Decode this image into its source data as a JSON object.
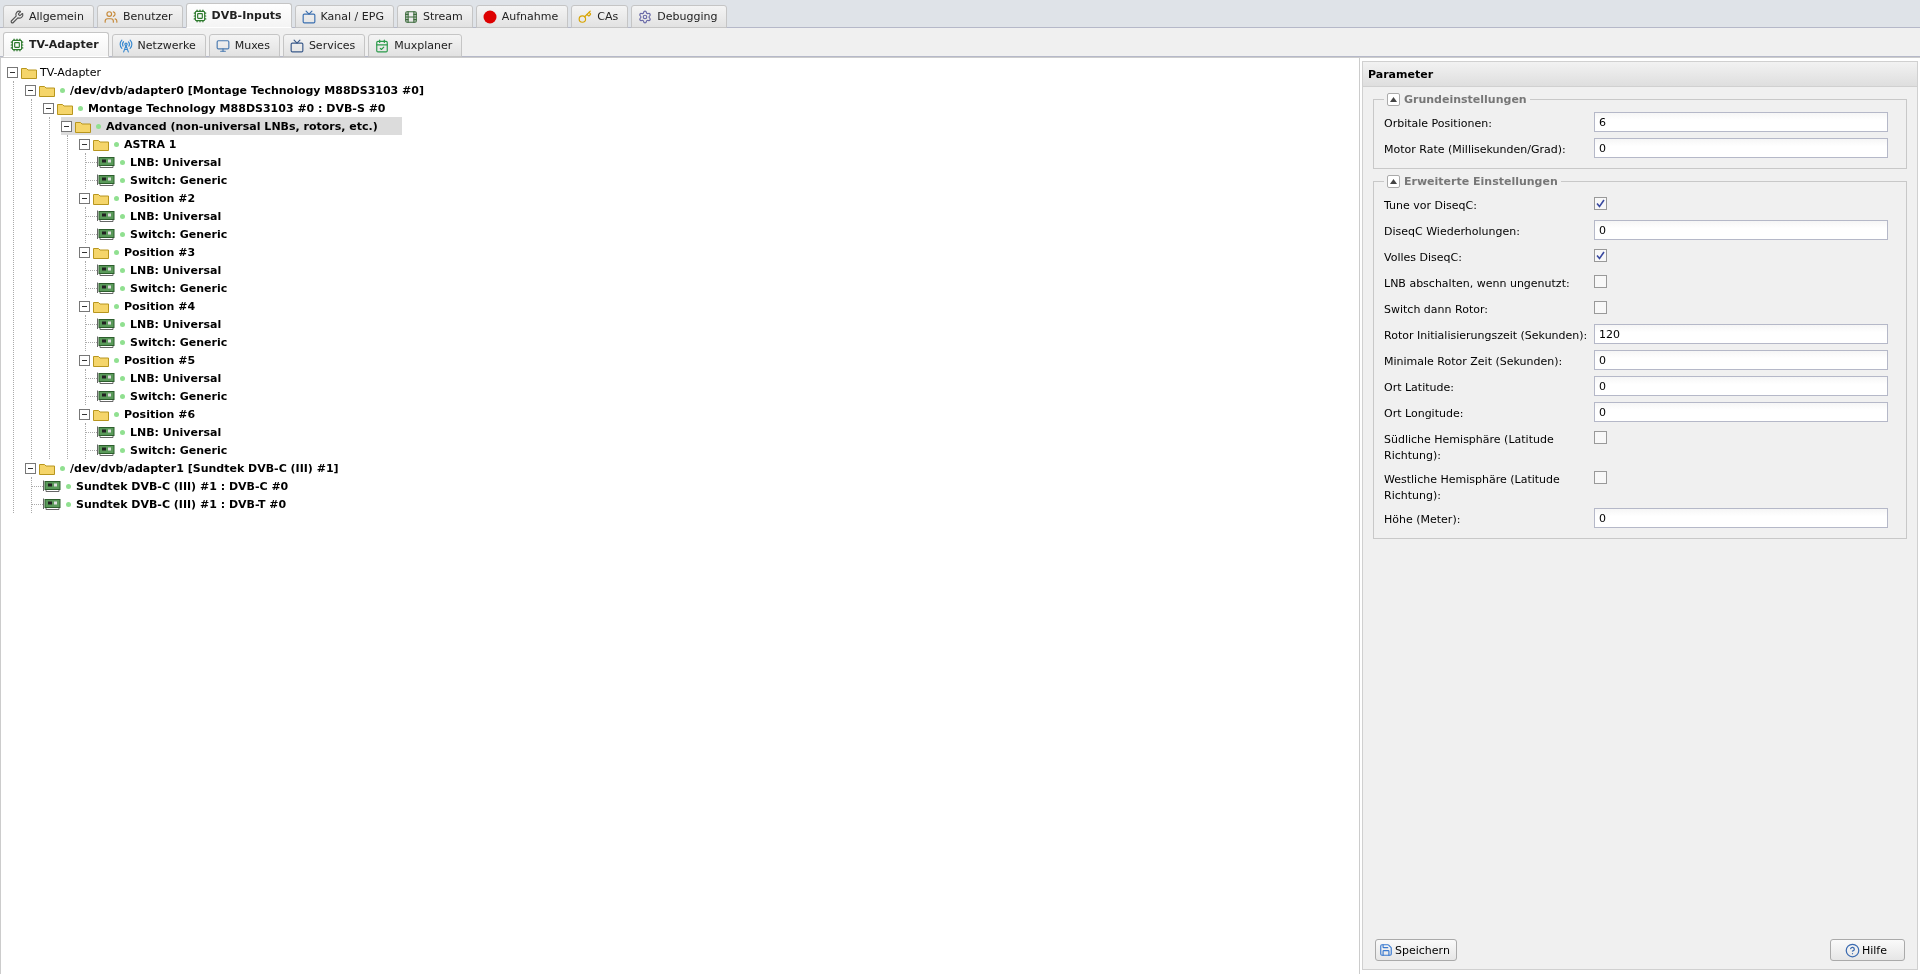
{
  "top_tabs": [
    {
      "label": "Allgemein",
      "selected": false
    },
    {
      "label": "Benutzer",
      "selected": false
    },
    {
      "label": "DVB-Inputs",
      "selected": true
    },
    {
      "label": "Kanal / EPG",
      "selected": false
    },
    {
      "label": "Stream",
      "selected": false
    },
    {
      "label": "Aufnahme",
      "selected": false
    },
    {
      "label": "CAs",
      "selected": false
    },
    {
      "label": "Debugging",
      "selected": false
    }
  ],
  "sub_tabs": [
    {
      "label": "TV-Adapter",
      "selected": true
    },
    {
      "label": "Netzwerke",
      "selected": false
    },
    {
      "label": "Muxes",
      "selected": false
    },
    {
      "label": "Services",
      "selected": false
    },
    {
      "label": "Muxplaner",
      "selected": false
    }
  ],
  "tree": {
    "label": "TV-Adapter",
    "kind": "root",
    "expanded": true,
    "selected": false,
    "children": [
      {
        "label": "/dev/dvb/adapter0 [Montage Technology M88DS3103 #0]",
        "kind": "folder",
        "expanded": true,
        "selected": false,
        "children": [
          {
            "label": "Montage Technology M88DS3103 #0 : DVB-S #0",
            "kind": "folder",
            "expanded": true,
            "selected": false,
            "children": [
              {
                "label": "Advanced (non-universal LNBs, rotors, etc.)",
                "kind": "folder",
                "expanded": true,
                "selected": true,
                "children": [
                  {
                    "label": "ASTRA 1",
                    "kind": "folder",
                    "expanded": true,
                    "selected": false,
                    "children": [
                      {
                        "label": "LNB: Universal",
                        "kind": "device",
                        "selected": false
                      },
                      {
                        "label": "Switch: Generic",
                        "kind": "device",
                        "selected": false
                      }
                    ]
                  },
                  {
                    "label": "Position #2",
                    "kind": "folder",
                    "expanded": true,
                    "selected": false,
                    "children": [
                      {
                        "label": "LNB: Universal",
                        "kind": "device",
                        "selected": false
                      },
                      {
                        "label": "Switch: Generic",
                        "kind": "device",
                        "selected": false
                      }
                    ]
                  },
                  {
                    "label": "Position #3",
                    "kind": "folder",
                    "expanded": true,
                    "selected": false,
                    "children": [
                      {
                        "label": "LNB: Universal",
                        "kind": "device",
                        "selected": false
                      },
                      {
                        "label": "Switch: Generic",
                        "kind": "device",
                        "selected": false
                      }
                    ]
                  },
                  {
                    "label": "Position #4",
                    "kind": "folder",
                    "expanded": true,
                    "selected": false,
                    "children": [
                      {
                        "label": "LNB: Universal",
                        "kind": "device",
                        "selected": false
                      },
                      {
                        "label": "Switch: Generic",
                        "kind": "device",
                        "selected": false
                      }
                    ]
                  },
                  {
                    "label": "Position #5",
                    "kind": "folder",
                    "expanded": true,
                    "selected": false,
                    "children": [
                      {
                        "label": "LNB: Universal",
                        "kind": "device",
                        "selected": false
                      },
                      {
                        "label": "Switch: Generic",
                        "kind": "device",
                        "selected": false
                      }
                    ]
                  },
                  {
                    "label": "Position #6",
                    "kind": "folder",
                    "expanded": true,
                    "selected": false,
                    "children": [
                      {
                        "label": "LNB: Universal",
                        "kind": "device",
                        "selected": false
                      },
                      {
                        "label": "Switch: Generic",
                        "kind": "device",
                        "selected": false
                      }
                    ]
                  }
                ]
              }
            ]
          }
        ]
      },
      {
        "label": "/dev/dvb/adapter1 [Sundtek DVB-C (III) #1]",
        "kind": "folder",
        "expanded": true,
        "selected": false,
        "children": [
          {
            "label": "Sundtek DVB-C (III) #1 : DVB-C #0",
            "kind": "device",
            "selected": false
          },
          {
            "label": "Sundtek DVB-C (III) #1 : DVB-T #0",
            "kind": "device",
            "selected": false
          }
        ]
      }
    ]
  },
  "panel": {
    "title": "Parameter",
    "sections": [
      {
        "title": "Grundeinstellungen",
        "expanded": true,
        "fields": [
          {
            "label": "Orbitale Positionen:",
            "kind": "text",
            "value": "6"
          },
          {
            "label": "Motor Rate (Millisekunden/Grad):",
            "kind": "text",
            "value": "0"
          }
        ]
      },
      {
        "title": "Erweiterte Einstellungen",
        "expanded": true,
        "fields": [
          {
            "label": "Tune vor DiseqC:",
            "kind": "checkbox",
            "checked": true
          },
          {
            "label": "DiseqC Wiederholungen:",
            "kind": "text",
            "value": "0"
          },
          {
            "label": "Volles DiseqC:",
            "kind": "checkbox",
            "checked": true
          },
          {
            "label": "LNB abschalten, wenn ungenutzt:",
            "kind": "checkbox",
            "checked": false
          },
          {
            "label": "Switch dann Rotor:",
            "kind": "checkbox",
            "checked": false
          },
          {
            "label": "Rotor Initialisierungszeit (Sekunden):",
            "kind": "text",
            "value": "120"
          },
          {
            "label": "Minimale Rotor Zeit (Sekunden):",
            "kind": "text",
            "value": "0"
          },
          {
            "label": "Ort Latitude:",
            "kind": "text",
            "value": "0"
          },
          {
            "label": "Ort Longitude:",
            "kind": "text",
            "value": "0"
          },
          {
            "label": "Südliche Hemisphäre (Latitude Richtung):",
            "kind": "checkbox",
            "checked": false
          },
          {
            "label": "Westliche Hemisphäre (Latitude Richtung):",
            "kind": "checkbox",
            "checked": false
          },
          {
            "label": "Höhe (Meter):",
            "kind": "text",
            "value": "0"
          }
        ]
      }
    ],
    "buttons": [
      {
        "label": "Speichern"
      },
      {
        "label": "Hilfe"
      }
    ]
  }
}
